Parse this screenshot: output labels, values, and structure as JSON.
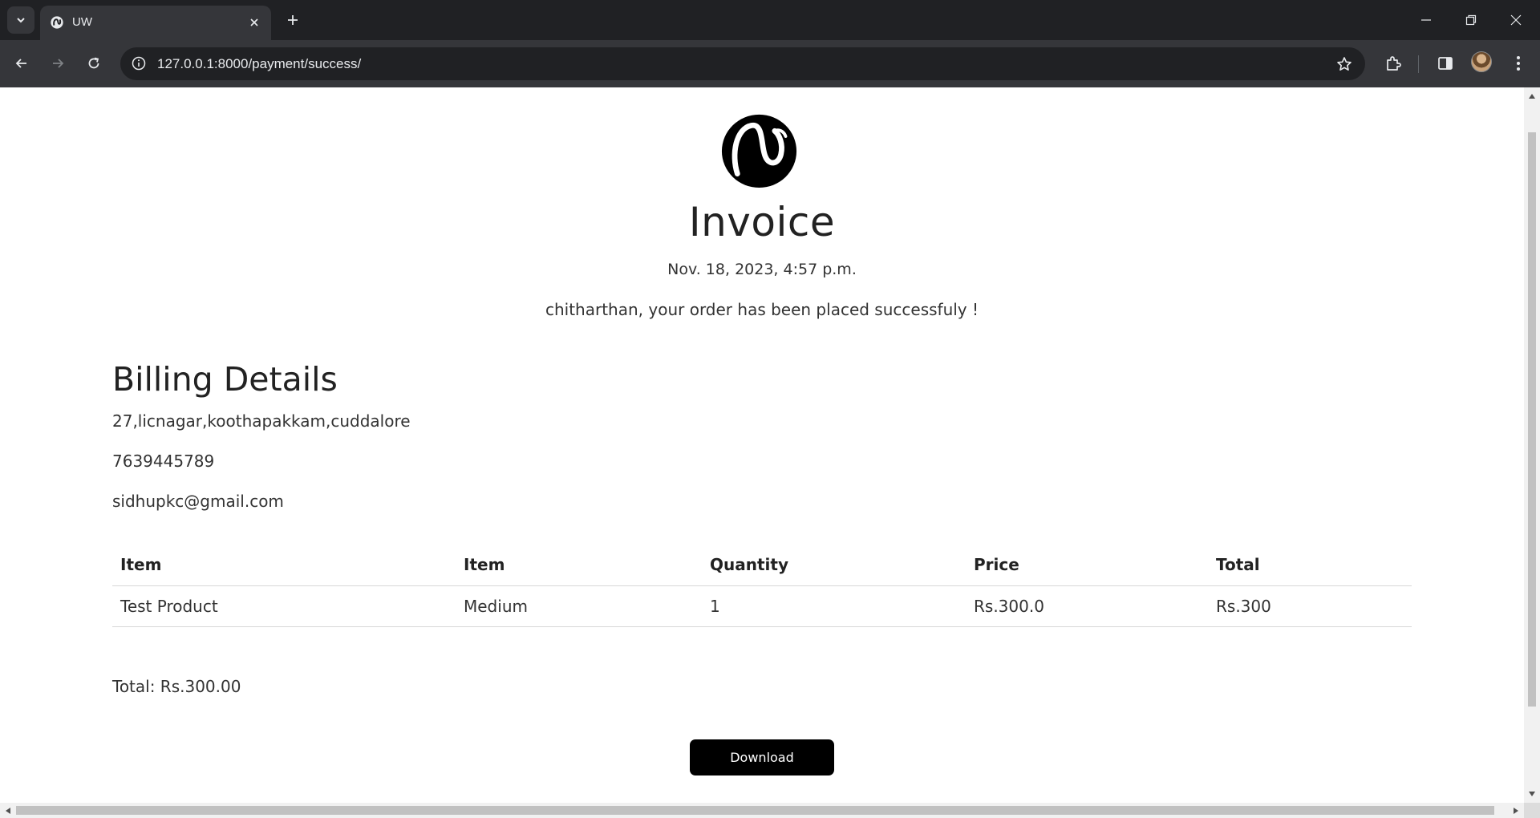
{
  "browser": {
    "tab": {
      "title": "UW",
      "favicon": "uw-logo-icon"
    },
    "address_bar": {
      "url": "127.0.0.1:8000/payment/success/"
    },
    "icons": {
      "tab_search": "chevron-down-icon",
      "tab_close": "close-icon",
      "new_tab": "plus-icon",
      "minimize": "minimize-icon",
      "restore": "restore-icon",
      "close_window": "close-icon",
      "back": "back-arrow-icon",
      "forward": "forward-arrow-icon",
      "reload": "reload-icon",
      "site_info": "info-icon",
      "bookmark": "star-icon",
      "extensions": "puzzle-icon",
      "side_panel": "side-panel-icon",
      "profile": "avatar",
      "menu": "kebab-menu-icon"
    },
    "colors": {
      "tabbar": "#202124",
      "toolbar": "#35363a",
      "omnibox": "#202124"
    }
  },
  "page": {
    "logo": "uw-logo-icon",
    "title": "Invoice",
    "date": "Nov. 18, 2023, 4:57 p.m.",
    "order_message": "chitharthan, your order has been placed successfuly !",
    "billing": {
      "heading": "Billing Details",
      "address": "27,licnagar,koothapakkam,cuddalore",
      "phone": "7639445789",
      "email": "sidhupkc@gmail.com"
    },
    "table": {
      "headers": [
        "Item",
        "Item",
        "Quantity",
        "Price",
        "Total"
      ],
      "rows": [
        [
          "Test Product",
          "Medium",
          "1",
          "Rs.300.0",
          "Rs.300"
        ]
      ]
    },
    "total": "Total: Rs.300.00",
    "download_label": "Download",
    "colors": {
      "button_bg": "#000000",
      "button_text": "#ffffff",
      "text": "#222222"
    }
  }
}
